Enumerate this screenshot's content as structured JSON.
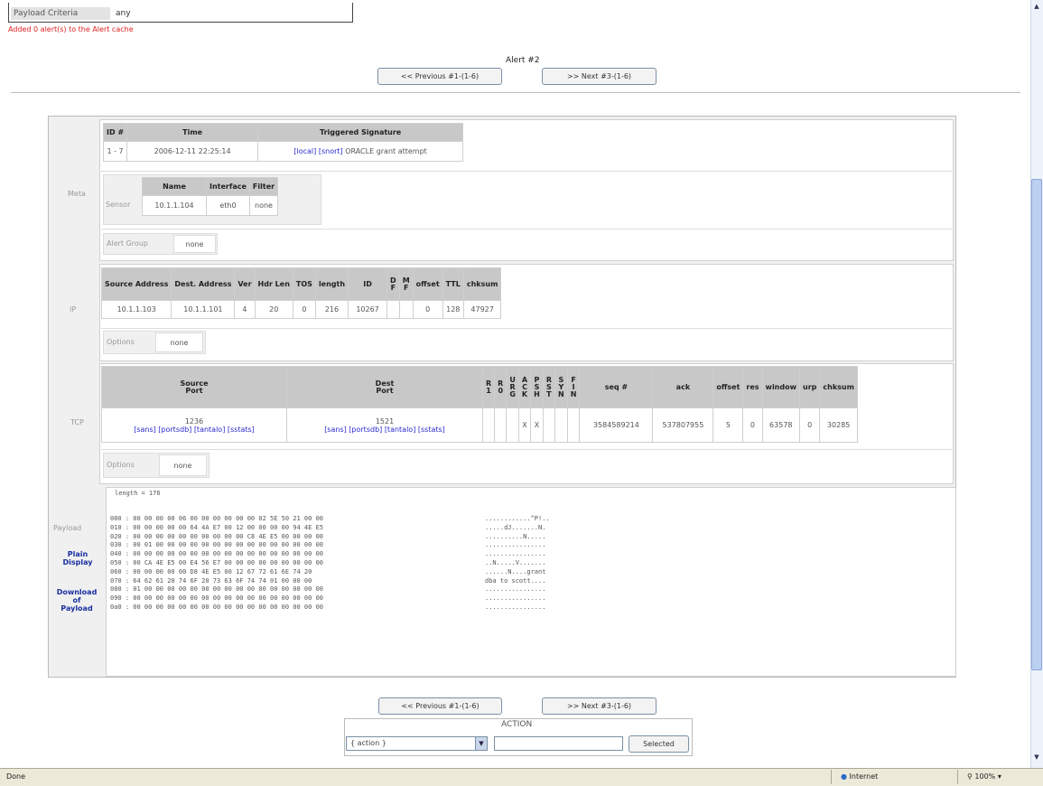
{
  "criteria": {
    "label": "Payload Criteria",
    "value": "any"
  },
  "added_message": "Added 0 alert(s) to the Alert cache",
  "alert_title": "Alert #2",
  "nav": {
    "previous": "<< Previous #1-(1-6)",
    "next": ">> Next #3-(1-6)"
  },
  "meta": {
    "label": "Meta",
    "headers": [
      "ID #",
      "Time",
      "Triggered Signature"
    ],
    "row": {
      "id": "1 - 7",
      "time": "2006-12-11 22:25:14",
      "sig_local": "[local]",
      "sig_snort": "[snort]",
      "sig_text": "ORACLE grant attempt"
    },
    "sensor_label": "Sensor",
    "sensor_headers": [
      "Name",
      "Interface",
      "Filter"
    ],
    "sensor_row": [
      "10.1.1.104",
      "eth0",
      "none"
    ],
    "alert_group_label": "Alert Group",
    "alert_group_value": "none"
  },
  "ip": {
    "label": "IP",
    "headers": [
      "Source Address",
      "Dest. Address",
      "Ver",
      "Hdr Len",
      "TOS",
      "length",
      "ID"
    ],
    "flag_headers": [
      [
        "D",
        "F"
      ],
      [
        "M",
        "F"
      ]
    ],
    "headers_tail": [
      "offset",
      "TTL",
      "chksum"
    ],
    "row": [
      "10.1.1.103",
      "10.1.1.101",
      "4",
      "20",
      "0",
      "216",
      "10267",
      "",
      "",
      "0",
      "128",
      "47927"
    ],
    "options_label": "Options",
    "options_value": "none"
  },
  "tcp": {
    "label": "TCP",
    "src_port_header": [
      "Source",
      "Port"
    ],
    "dst_port_header": [
      "Dest",
      "Port"
    ],
    "flag_headers": [
      [
        "R",
        "1"
      ],
      [
        "R",
        "0"
      ],
      [
        "U",
        "R",
        "G"
      ],
      [
        "A",
        "C",
        "K"
      ],
      [
        "P",
        "S",
        "H"
      ],
      [
        "R",
        "S",
        "T"
      ],
      [
        "S",
        "Y",
        "N"
      ],
      [
        "F",
        "I",
        "N"
      ]
    ],
    "tail_headers": [
      "seq #",
      "ack",
      "offset",
      "res",
      "window",
      "urp",
      "chksum"
    ],
    "src_port": "1236",
    "dst_port": "1521",
    "port_links": [
      "[sans]",
      "[portsdb]",
      "[tantalo]",
      "[sstats]"
    ],
    "flag_values": [
      "",
      "",
      "",
      "X",
      "X",
      "",
      "",
      ""
    ],
    "tail_values": [
      "3584589214",
      "537807955",
      "5",
      "0",
      "63578",
      "0",
      "30285"
    ],
    "options_label": "Options",
    "options_value": "none"
  },
  "payload": {
    "label": "Payload",
    "length": "length = 176",
    "plain_display": [
      "Plain",
      "Display"
    ],
    "download": [
      "Download",
      "of",
      "Payload"
    ],
    "hex": "000 : 00 00 00 00 06 00 00 00 00 00 00 02 5E 50 21 00 00\n010 : 00 00 00 00 00 64 4A E7 00 12 00 00 00 00 94 4E E5\n020 : 00 00 00 00 00 00 00 00 00 00 C8 4E E5 00 00 00 00\n030 : 00 01 00 00 00 00 00 00 00 00 00 00 00 00 00 00 00\n040 : 00 00 00 00 00 00 00 00 00 00 00 00 00 00 00 00 00\n050 : 00 CA 4E E5 00 E4 56 E7 00 00 00 00 00 00 00 00 00\n060 : 00 00 00 00 00 D8 4E E5 00 12 67 72 61 6E 74 20\n070 : 64 62 61 20 74 6F 20 73 63 6F 74 74 01 00 00 00\n080 : 01 00 00 00 00 00 00 00 00 00 00 00 00 00 00 00 00\n090 : 00 00 00 00 00 00 00 00 00 00 00 00 00 00 00 00 00\n0a0 : 00 00 00 00 00 00 00 00 00 00 00 00 00 00 00 00 00",
    "ascii": "............^P!..\n.....dJ.......N.\n..........N.....\n................\n................\n..N.....V.......\n......N....grant\ndba to scott....\n................\n................\n................"
  },
  "action": {
    "title": "ACTION",
    "select_value": "{ action }",
    "selected_button": "Selected"
  },
  "status": {
    "left": "Done",
    "zone": "Internet",
    "zoom": "100%"
  }
}
